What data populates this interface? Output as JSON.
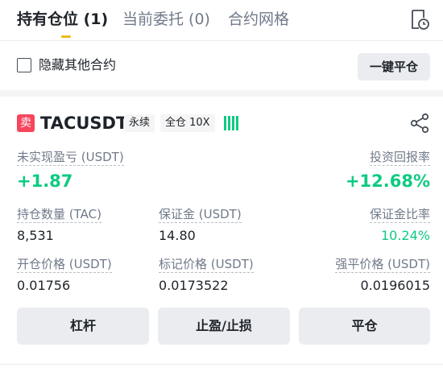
{
  "tabs": [
    {
      "label": "持有仓位 (1)",
      "active": true
    },
    {
      "label": "当前委托 (0)",
      "active": false
    },
    {
      "label": "合约网格",
      "active": false
    }
  ],
  "tab_icon": "order-history-icon",
  "hide_other": {
    "label": "隐藏其他合约",
    "checked": false
  },
  "close_all_label": "一键平仓",
  "position": {
    "side_badge": "卖",
    "symbol": "TACUSDT",
    "perp_tag": "永续",
    "margin_tag": "全仓 10X",
    "risk_icon": "risk-level-icon",
    "share_icon": "share-icon",
    "unrealized_pnl": {
      "label": "未实现盈亏 (USDT)",
      "value": "+1.87"
    },
    "roe": {
      "label": "投资回报率",
      "value": "+12.68%"
    },
    "size": {
      "label": "持仓数量 (TAC)",
      "value": "8,531"
    },
    "margin": {
      "label": "保证金 (USDT)",
      "value": "14.80"
    },
    "margin_ratio": {
      "label": "保证金比率",
      "value": "10.24%"
    },
    "entry_price": {
      "label": "开仓价格 (USDT)",
      "value": "0.01756"
    },
    "mark_price": {
      "label": "标记价格 (USDT)",
      "value": "0.0173522"
    },
    "liq_price": {
      "label": "强平价格 (USDT)",
      "value": "0.0196015"
    }
  },
  "actions": {
    "leverage": "杠杆",
    "tpsl": "止盈/止损",
    "close": "平仓"
  },
  "colors": {
    "green": "#0ecb81",
    "red": "#f6465d",
    "accent": "#f0b90b",
    "text": "#1e2329",
    "muted": "#707a8a"
  }
}
